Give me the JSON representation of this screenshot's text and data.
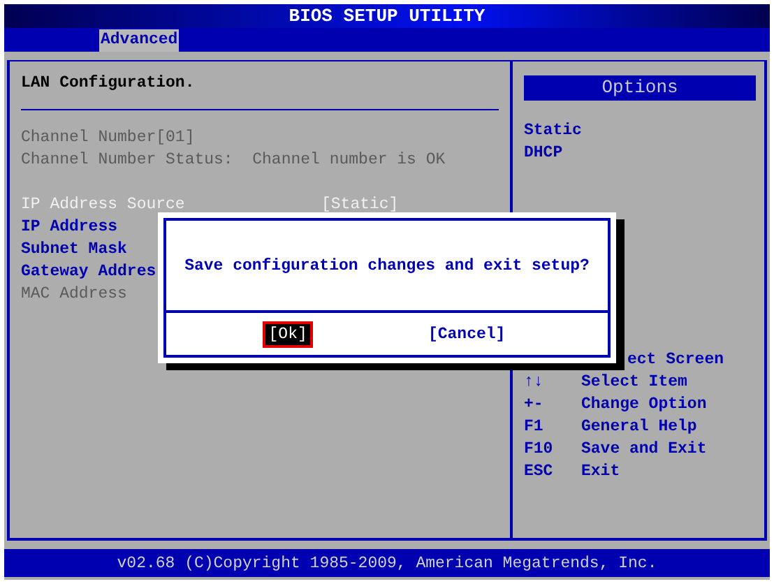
{
  "window": {
    "title": "BIOS SETUP UTILITY"
  },
  "tabs": [
    {
      "label": "Advanced",
      "selected": true
    }
  ],
  "main": {
    "heading": "LAN Configuration.",
    "items": [
      {
        "label": "Channel Number[01]",
        "disabled": true,
        "selected": false
      },
      {
        "label": "Channel Number Status:  Channel number is OK",
        "disabled": true,
        "selected": false
      },
      {
        "label": "IP Address Source",
        "value": "[Static]",
        "disabled": false,
        "selected": true,
        "gap": true
      },
      {
        "label": "IP Address",
        "disabled": false,
        "selected": false
      },
      {
        "label": "Subnet Mask",
        "disabled": false,
        "selected": false
      },
      {
        "label": "Gateway Addres",
        "disabled": false,
        "selected": false
      },
      {
        "label": "MAC Address",
        "disabled": true,
        "selected": false
      }
    ]
  },
  "side": {
    "heading": "Options",
    "options": [
      "Static",
      "DHCP"
    ],
    "hints": [
      {
        "action": "ect Screen"
      },
      {
        "key": "↑↓",
        "action": "Select Item"
      },
      {
        "key": "+-",
        "action": "Change Option"
      },
      {
        "key": "F1",
        "action": "General Help"
      },
      {
        "key": "F10",
        "action": "Save and Exit"
      },
      {
        "key": "ESC",
        "action": "Exit"
      }
    ]
  },
  "dialog": {
    "message": "Save configuration changes and exit setup?",
    "buttons": [
      {
        "label": "[Ok]",
        "selected": true
      },
      {
        "label": "[Cancel]",
        "selected": false
      }
    ]
  },
  "status_bar": "v02.68 (C)Copyright 1985-2009, American Megatrends, Inc."
}
